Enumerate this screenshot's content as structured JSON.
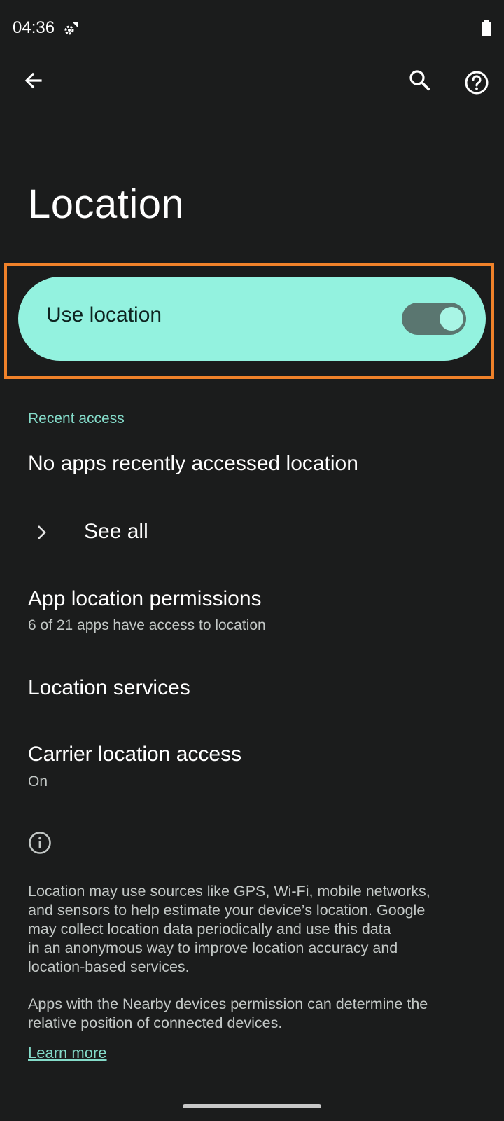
{
  "status_bar": {
    "time": "04:36"
  },
  "toolbar": {
    "back_icon": "back-arrow-icon",
    "search_icon": "search-icon",
    "help_icon": "help-icon"
  },
  "page": {
    "title": "Location"
  },
  "main_switch": {
    "label": "Use location",
    "enabled": true,
    "accent_color": "#93f2df"
  },
  "recent_access": {
    "header": "Recent access",
    "empty_text": "No apps recently accessed location",
    "see_all_label": "See all"
  },
  "settings_rows": [
    {
      "title": "App location permissions",
      "subtitle": "6 of 21 apps have access to location"
    },
    {
      "title": "Location services",
      "subtitle": ""
    },
    {
      "title": "Carrier location access",
      "subtitle": "On"
    }
  ],
  "footer": {
    "paragraph1_lines": [
      "Location may use sources like GPS, Wi-Fi, mobile networks,",
      "and sensors to help estimate your device’s location. Google",
      "may collect location data periodically and use this data",
      "in an anonymous way to improve location accuracy and",
      "location-based services."
    ],
    "paragraph2_lines": [
      "Apps with the Nearby devices permission can determine the",
      "relative position of connected devices."
    ],
    "learn_more": "Learn more"
  }
}
